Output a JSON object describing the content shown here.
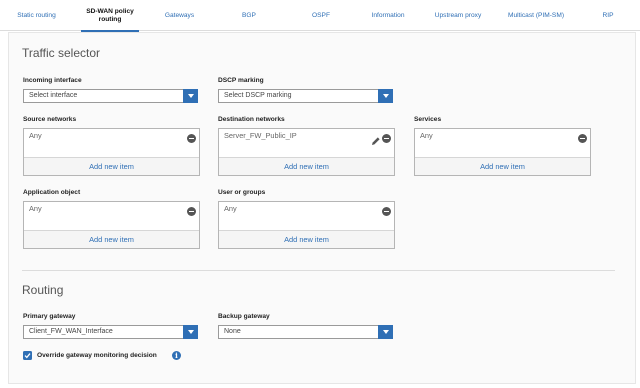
{
  "tabs": [
    {
      "label": "Static routing",
      "active": false
    },
    {
      "label": "SD-WAN policy routing",
      "active": true
    },
    {
      "label": "Gateways",
      "active": false
    },
    {
      "label": "BGP",
      "active": false
    },
    {
      "label": "OSPF",
      "active": false
    },
    {
      "label": "Information",
      "active": false
    },
    {
      "label": "Upstream proxy",
      "active": false
    },
    {
      "label": "Multicast (PIM-SM)",
      "active": false
    },
    {
      "label": "RIP",
      "active": false
    }
  ],
  "traffic_selector": {
    "title": "Traffic selector",
    "incoming_interface": {
      "label": "Incoming interface",
      "placeholder": "Select interface"
    },
    "dscp_marking": {
      "label": "DSCP marking",
      "placeholder": "Select DSCP marking"
    },
    "source_networks": {
      "label": "Source networks",
      "value": "Any",
      "add_label": "Add new item"
    },
    "destination_networks": {
      "label": "Destination networks",
      "value": "Server_FW_Public_IP",
      "add_label": "Add new item"
    },
    "services": {
      "label": "Services",
      "value": "Any",
      "add_label": "Add new item"
    },
    "application_object": {
      "label": "Application object",
      "value": "Any",
      "add_label": "Add new item"
    },
    "user_or_groups": {
      "label": "User or groups",
      "value": "Any",
      "add_label": "Add new item"
    }
  },
  "routing": {
    "title": "Routing",
    "primary_gateway": {
      "label": "Primary gateway",
      "value": "Client_FW_WAN_Interface"
    },
    "backup_gateway": {
      "label": "Backup gateway",
      "value": "None"
    },
    "override_monitoring": {
      "label": "Override gateway monitoring decision",
      "checked": true
    }
  },
  "colors": {
    "accent": "#2f6fb5"
  },
  "icons": {
    "dropdown": "chevron-down-icon",
    "remove": "minus-circle-icon",
    "edit": "pencil-icon",
    "info": "info-icon",
    "check": "check-icon"
  }
}
